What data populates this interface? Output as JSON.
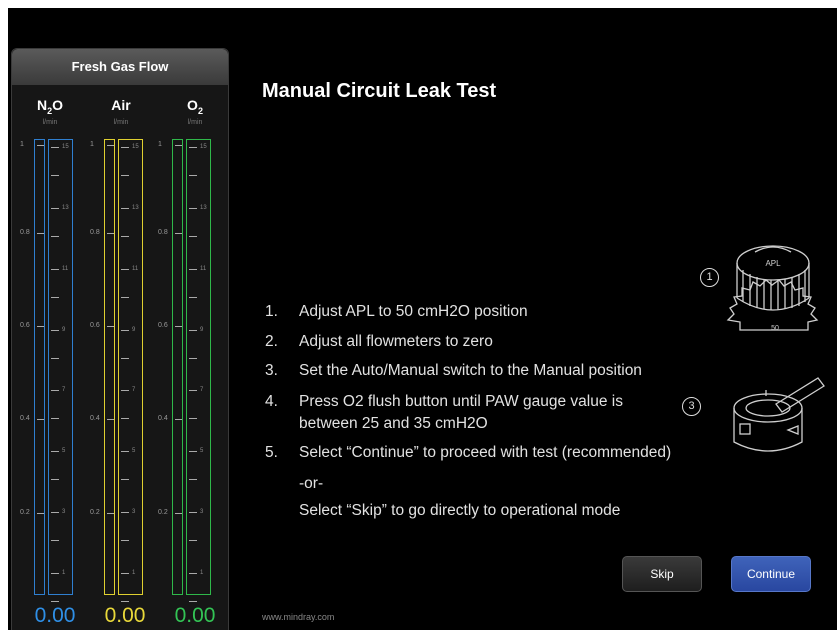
{
  "panel": {
    "title": "Fresh Gas Flow",
    "columns": [
      {
        "name": "N2O",
        "display_base": "N",
        "display_sub": "2",
        "display_tail": "O",
        "unit": "l/min",
        "value": "0.00",
        "color": "#2f7fd0",
        "level": 0
      },
      {
        "name": "Air",
        "display_base": "Air",
        "display_sub": "",
        "display_tail": "",
        "unit": "l/min",
        "value": "0.00",
        "color": "#e0d030",
        "level": 0
      },
      {
        "name": "O2",
        "display_base": "O",
        "display_sub": "2",
        "display_tail": "",
        "unit": "l/min",
        "value": "0.00",
        "color": "#2fb84a",
        "level": 0
      }
    ],
    "scale_left": [
      "1",
      "0.8",
      "0.6",
      "0.4",
      "0.2"
    ],
    "scale_right": [
      "15",
      "13",
      "11",
      "9",
      "7",
      "5",
      "3",
      "1"
    ]
  },
  "main": {
    "title": "Manual Circuit Leak Test",
    "steps": [
      {
        "num": "1.",
        "text": "Adjust APL to 50 cmH2O position"
      },
      {
        "num": "2.",
        "text": "Adjust all flowmeters to zero"
      },
      {
        "num": "3.",
        "text": "Set the Auto/Manual switch to the Manual position"
      },
      {
        "num": "4.",
        "text": "Press O2 flush button until PAW gauge value is"
      },
      {
        "num": "",
        "text": "between 25 and 35 cmH2O"
      },
      {
        "num": "5.",
        "text": "Select “Continue” to proceed with test (recommended)"
      }
    ],
    "or_text": "-or-",
    "skip_text": "Select “Skip” to go directly to operational mode",
    "illustration": {
      "label1": "1",
      "label2": "3",
      "apl_label": "APL",
      "apl_value": "50"
    }
  },
  "buttons": {
    "skip": "Skip",
    "continue": "Continue"
  },
  "footer": "www.mindray.com"
}
